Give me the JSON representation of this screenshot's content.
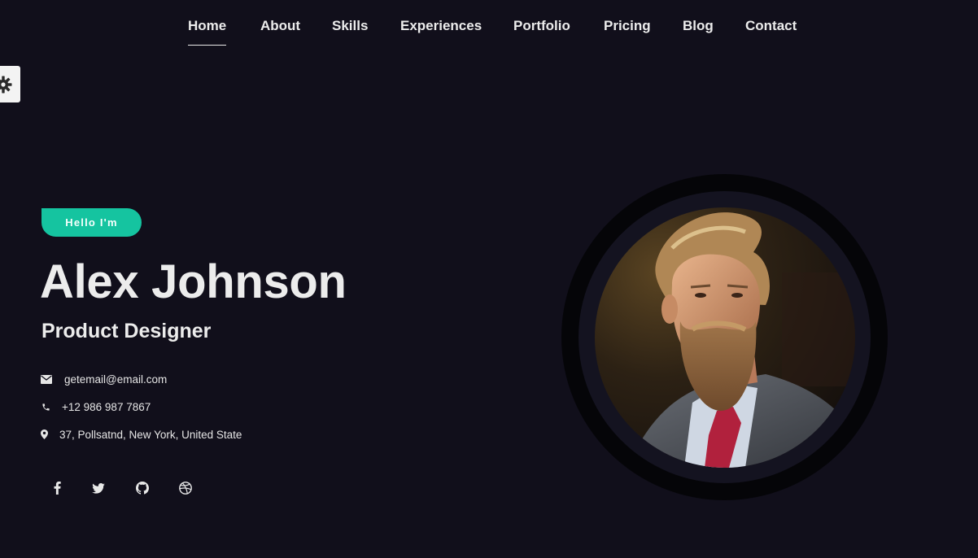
{
  "nav": {
    "items": [
      {
        "label": "Home",
        "active": true
      },
      {
        "label": "About"
      },
      {
        "label": "Skills"
      },
      {
        "label": "Experiences"
      },
      {
        "label": "Portfolio"
      },
      {
        "label": "Pricing"
      },
      {
        "label": "Blog"
      },
      {
        "label": "Contact"
      }
    ]
  },
  "settings": {
    "icon": "gear-icon"
  },
  "hero": {
    "badge": "Hello I'm",
    "name": "Alex Johnson",
    "role": "Product Designer"
  },
  "contact": {
    "email": {
      "icon": "envelope-icon",
      "text": "getemail@email.com"
    },
    "phone": {
      "icon": "phone-icon",
      "text": "+12 986 987 7867"
    },
    "address": {
      "icon": "map-marker-icon",
      "text": "37, Pollsatnd, New York, United State"
    }
  },
  "social": [
    {
      "icon": "facebook-icon"
    },
    {
      "icon": "twitter-icon"
    },
    {
      "icon": "github-icon"
    },
    {
      "icon": "dribbble-icon"
    }
  ],
  "colors": {
    "background": "#110f1b",
    "accent": "#15c4a0",
    "text": "#ececec"
  }
}
